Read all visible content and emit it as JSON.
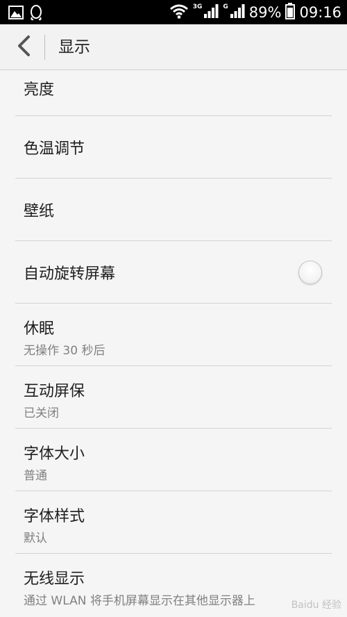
{
  "status_bar": {
    "network_3g": "3G",
    "network_g": "G",
    "battery": "89%",
    "time": "09:16"
  },
  "header": {
    "title": "显示"
  },
  "settings": [
    {
      "title": "亮度"
    },
    {
      "title": "色温调节"
    },
    {
      "title": "壁纸"
    },
    {
      "title": "自动旋转屏幕",
      "toggle": "off"
    },
    {
      "title": "休眠",
      "subtitle": "无操作 30 秒后"
    },
    {
      "title": "互动屏保",
      "subtitle": "已关闭"
    },
    {
      "title": "字体大小",
      "subtitle": "普通"
    },
    {
      "title": "字体样式",
      "subtitle": "默认"
    },
    {
      "title": "无线显示",
      "subtitle": "通过 WLAN 将手机屏幕显示在其他显示器上"
    }
  ],
  "watermark": "Baidu 经验"
}
